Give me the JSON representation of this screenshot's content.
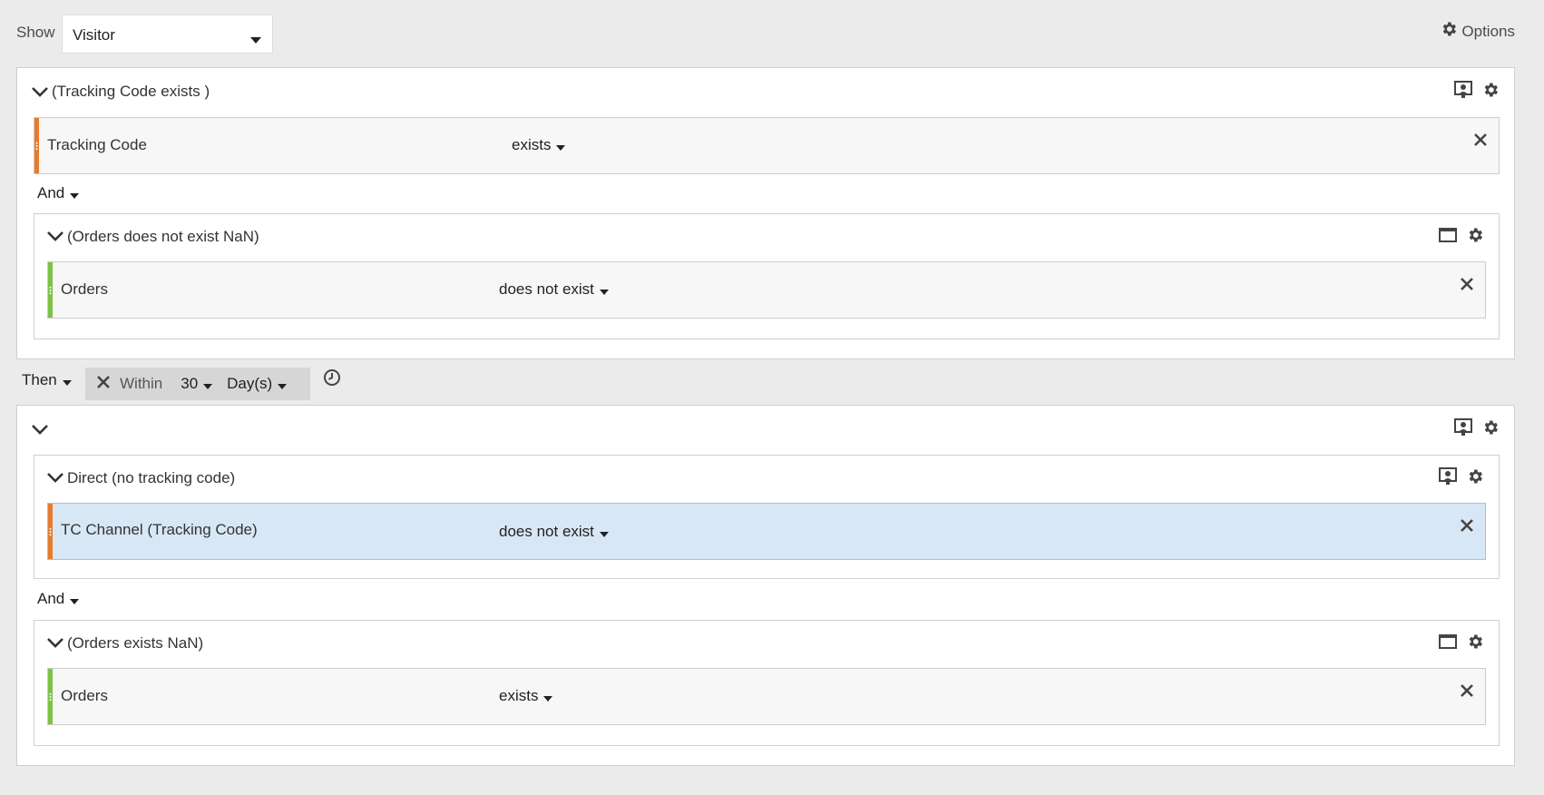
{
  "topbar": {
    "show_label": "Show",
    "show_value": "Visitor",
    "options_label": "Options"
  },
  "container1": {
    "title": "(Tracking Code exists )",
    "rule": {
      "name": "Tracking Code",
      "operator": "exists",
      "bar_color": "#e97a29"
    },
    "logic": "And",
    "nested": {
      "title": "(Orders does not exist NaN)",
      "rule": {
        "name": "Orders",
        "operator": "does not exist",
        "bar_color": "#7cc243"
      }
    }
  },
  "then": {
    "label": "Then",
    "within_label": "Within",
    "within_value": "30",
    "within_unit": "Day(s)"
  },
  "container2": {
    "title": "",
    "direct": {
      "title": "Direct (no tracking code)",
      "rule": {
        "name": "TC Channel (Tracking Code)",
        "operator": "does not exist",
        "bar_color": "#e97a29"
      }
    },
    "logic": "And",
    "orders": {
      "title": "(Orders exists NaN)",
      "rule": {
        "name": "Orders",
        "operator": "exists",
        "bar_color": "#7cc243"
      }
    }
  },
  "icons": {
    "chevron": "chevron-down-icon",
    "gear": "gear-icon",
    "close": "close-icon",
    "visitor_scope": "visitor-scope-icon",
    "window": "window-icon",
    "clock": "clock-icon"
  },
  "colors": {
    "selected_bg": "#d8e7f5",
    "orange": "#e97a29",
    "green": "#7cc243"
  }
}
